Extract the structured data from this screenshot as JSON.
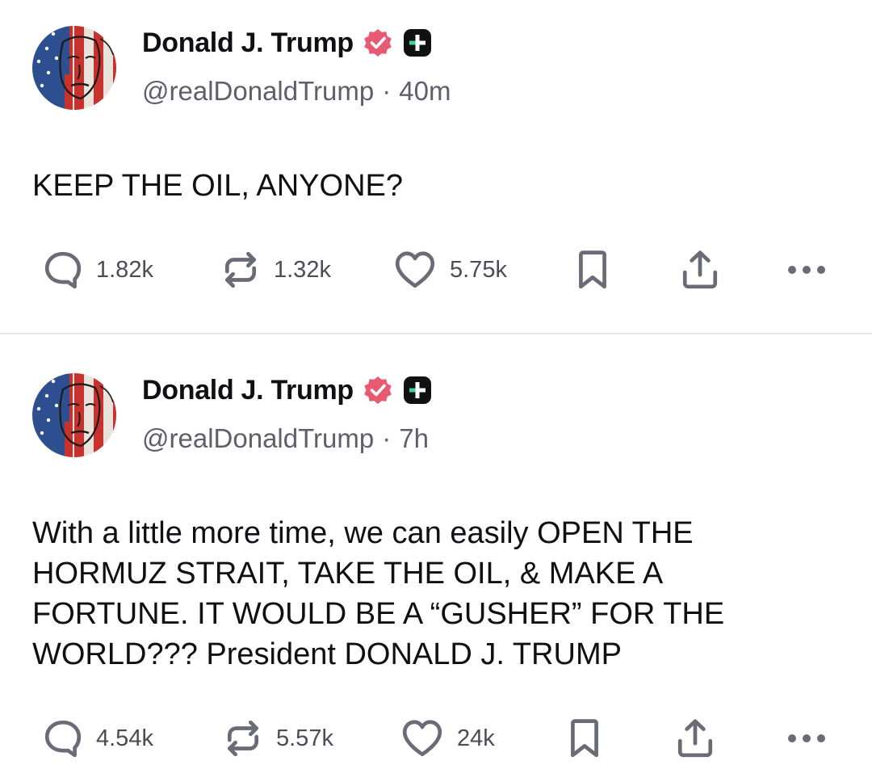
{
  "posts": [
    {
      "author_name": "Donald J. Trump",
      "handle": "@realDonaldTrump",
      "separator": "·",
      "time": "40m",
      "text": "KEEP THE OIL, ANYONE?",
      "replies": "1.82k",
      "reposts": "1.32k",
      "likes": "5.75k"
    },
    {
      "author_name": "Donald J. Trump",
      "handle": "@realDonaldTrump",
      "separator": "·",
      "time": "7h",
      "text": "With a little more time, we can easily OPEN THE\nHORMUZ STRAIT, TAKE THE OIL, & MAKE A\nFORTUNE. IT WOULD BE A “GUSHER” FOR THE\nWORLD??? President DONALD J. TRUMP",
      "replies": "4.54k",
      "reposts": "5.57k",
      "likes": "24k"
    }
  ],
  "icons": {
    "verified": "verified-badge-icon",
    "plus_badge": "plus-badge-icon",
    "reply": "comment-icon",
    "repost": "repost-icon",
    "like": "heart-icon",
    "bookmark": "bookmark-icon",
    "share": "share-icon",
    "more": "more-icon"
  },
  "colors": {
    "text": "#0f0f14",
    "secondary": "#5f5f6b",
    "icon": "#6b6b78",
    "verified": "#e85a71",
    "plus_badge": "#111111",
    "plus_accent": "#39d3a5",
    "divider": "#e6e6ea"
  }
}
